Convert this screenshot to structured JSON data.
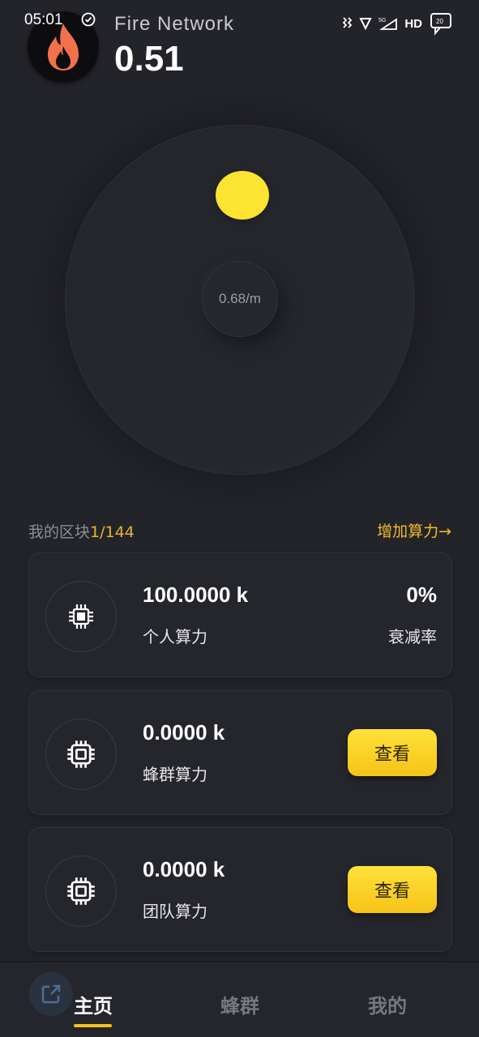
{
  "status_bar": {
    "time": "05:01",
    "hd": "HD",
    "network": "5G",
    "battery_level": "20"
  },
  "header": {
    "app_name": "Fire Network",
    "balance": "0.51",
    "logo_icon": "fire-icon"
  },
  "dial": {
    "rate": "0.68/m",
    "indicator_color": "#fde332"
  },
  "section": {
    "title": "我的区块",
    "count": "1/144",
    "add_power": "增加算力→"
  },
  "cards": [
    {
      "value": "100.0000 k",
      "label": "个人算力",
      "right_value": "0%",
      "right_label": "衰减率"
    },
    {
      "value": "0.0000 k",
      "label": "蜂群算力",
      "button": "查看"
    },
    {
      "value": "0.0000 k",
      "label": "团队算力",
      "button": "查看"
    }
  ],
  "nav": {
    "items": [
      {
        "label": "主页",
        "active": true
      },
      {
        "label": "蜂群",
        "active": false
      },
      {
        "label": "我的",
        "active": false
      }
    ]
  },
  "colors": {
    "background": "#23242a",
    "accent": "#f5c11e",
    "accent_text": "#f1b92b"
  }
}
